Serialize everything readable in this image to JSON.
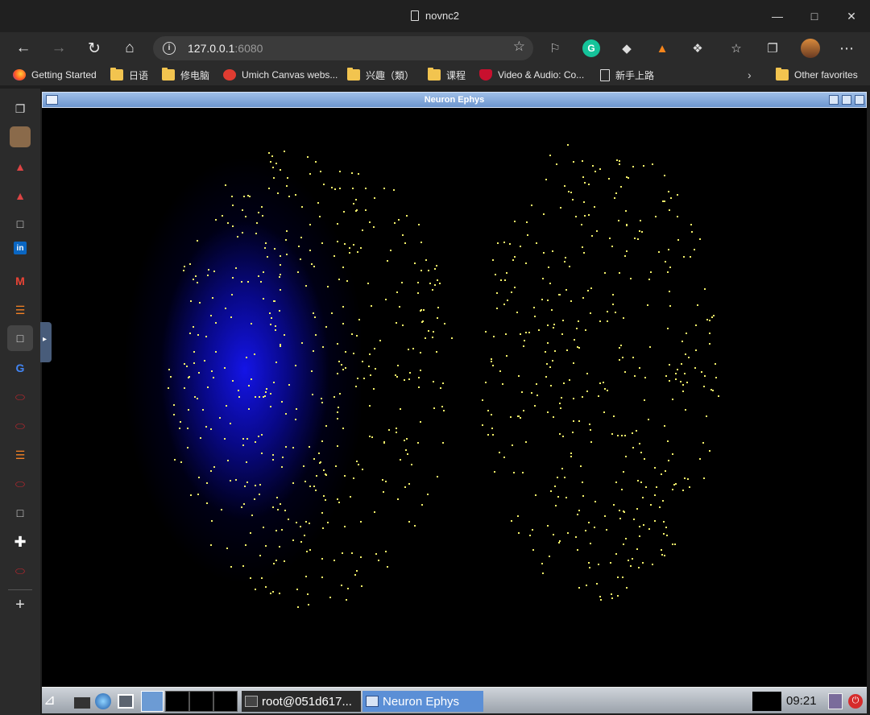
{
  "window": {
    "title": "novnc2"
  },
  "nav": {
    "url_host": "127.0.0.1",
    "url_port": ":6080"
  },
  "favorites": [
    {
      "label": "Getting Started",
      "icon": "firefox-icon"
    },
    {
      "label": "日语",
      "icon": "folder-icon"
    },
    {
      "label": "修电脑",
      "icon": "folder-icon"
    },
    {
      "label": "Umich Canvas webs...",
      "icon": "canvas-icon"
    },
    {
      "label": "兴趣（類）",
      "icon": "folder-icon"
    },
    {
      "label": "课程",
      "icon": "folder-icon"
    },
    {
      "label": "Video & Audio: Co...",
      "icon": "shield-icon"
    },
    {
      "label": "新手上路",
      "icon": "page-icon"
    },
    {
      "label": "Other favorites",
      "icon": "folder-icon"
    }
  ],
  "vnc": {
    "window_title": "Neuron Ephys",
    "taskbar": {
      "tasks": [
        {
          "label": "root@051d617...",
          "icon": "terminal-icon",
          "active": false
        },
        {
          "label": "Neuron Ephys",
          "icon": "window-icon",
          "active": true
        }
      ],
      "clock": "09:21"
    }
  },
  "colors": {
    "dot": "#f3f06a",
    "glow": "#1414e6",
    "active_task": "#5b8fd6"
  }
}
